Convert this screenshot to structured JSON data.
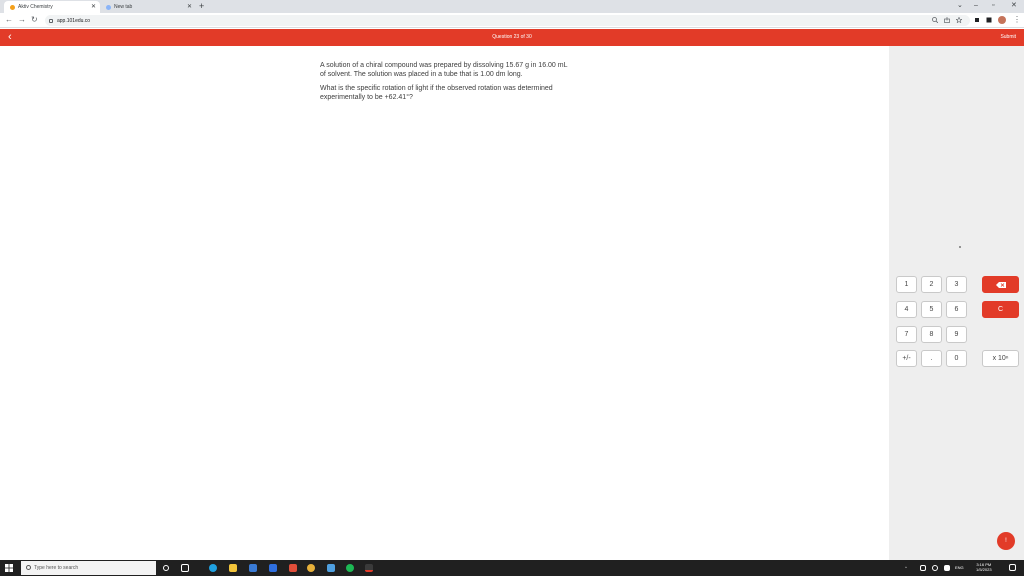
{
  "browser": {
    "tabs": [
      {
        "label": "Aktiv Chemistry",
        "active": true
      },
      {
        "label": "New tab",
        "active": false
      }
    ],
    "address": "app.101edu.co"
  },
  "appbar": {
    "back_icon": "chevron-left-icon",
    "title": "Question 23 of 30",
    "submit_label": "Submit"
  },
  "question": {
    "paragraph1": "A solution of a chiral compound was prepared by dissolving 15.67 g in 16.00 mL of solvent. The solution was placed in a tube that is 1.00 dm long.",
    "paragraph2": "What is the specific rotation of light if the observed rotation was determined experimentally to be +62.41°?"
  },
  "calculator": {
    "keys": {
      "k1": "1",
      "k2": "2",
      "k3": "3",
      "k4": "4",
      "k5": "5",
      "k6": "6",
      "k7": "7",
      "k8": "8",
      "k9": "9",
      "plusminus": "+/-",
      "dot": ".",
      "k0": "0",
      "clear": "C",
      "exp": "x 10ⁿ"
    }
  },
  "help_label": "!",
  "taskbar": {
    "search_placeholder": "Type here to search",
    "tray_lang": "ENG",
    "time": "3:16 PM",
    "date": "1/5/2023"
  },
  "colors": {
    "accent": "#e23b28",
    "panel": "#eeeeee"
  }
}
